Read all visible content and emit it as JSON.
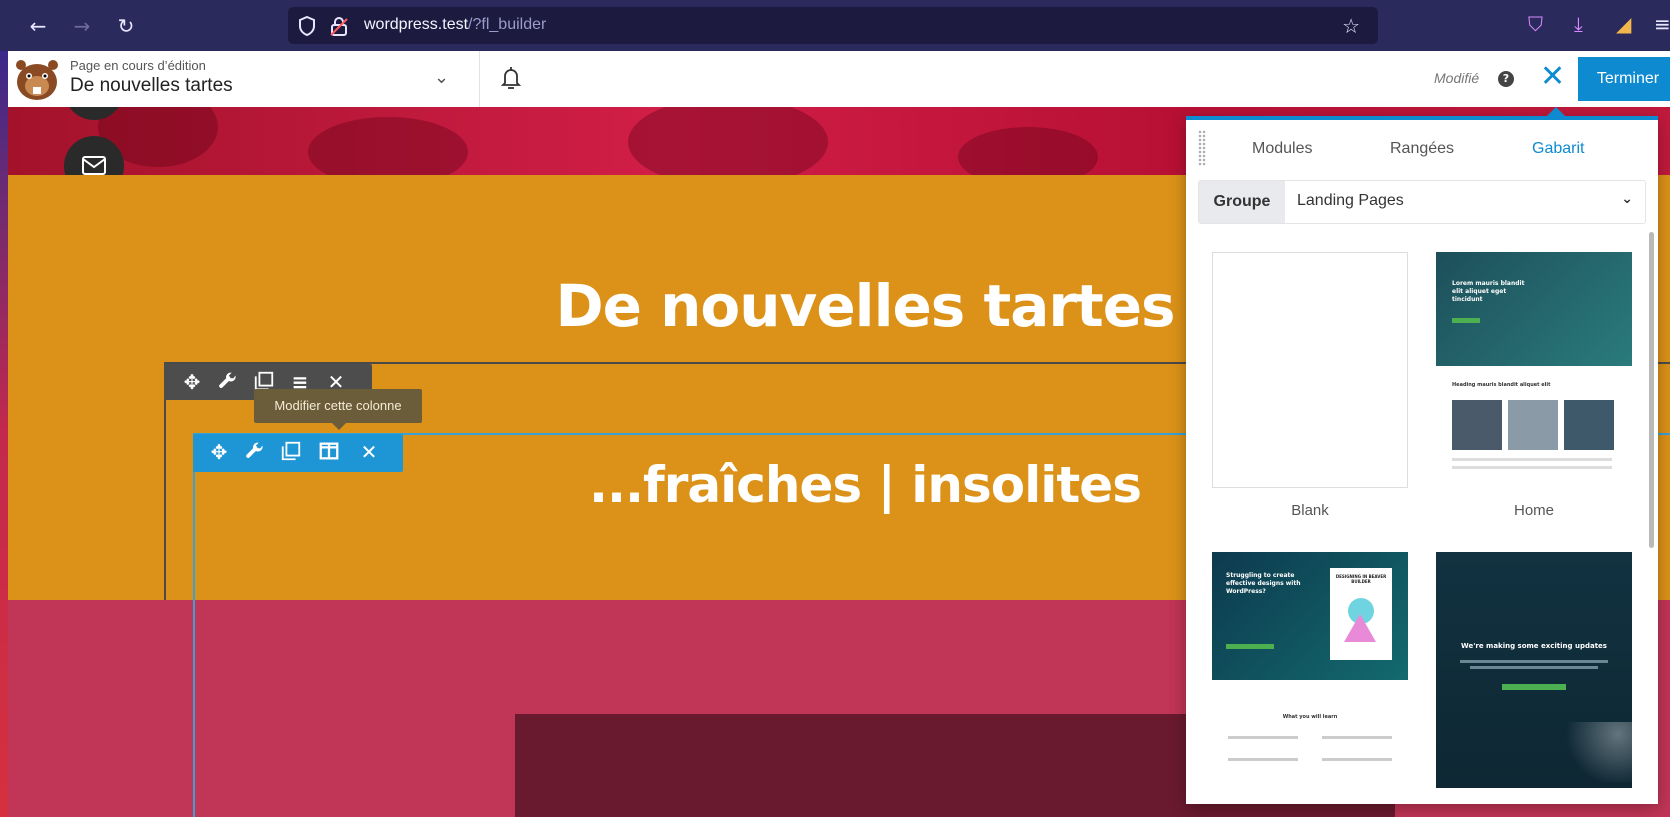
{
  "browser": {
    "url_host": "wordpress.test",
    "url_path": "/?fl_builder"
  },
  "builder_bar": {
    "subtitle": "Page en cours d’édition",
    "page_title": "De nouvelles tartes",
    "status": "Modifié",
    "done_label": "Terminer"
  },
  "page": {
    "heading_1": "De nouvelles tartes",
    "heading_2": "...fraîches | insolites"
  },
  "tooltip": "Modifier cette colonne",
  "panel": {
    "tabs": [
      "Modules",
      "Rangées",
      "Gabarit"
    ],
    "active_tab": "Gabarit",
    "group_label": "Groupe",
    "group_value": "Landing Pages",
    "templates": [
      {
        "label": "Blank"
      },
      {
        "label": "Home"
      }
    ],
    "preview_text": {
      "home_hero": "Lorem mauris blandit elit aliquet eget tincidunt",
      "home_heading": "Heading mauris blandit aliquet elit",
      "t3_hero": "Struggling to create effective designs with WordPress?",
      "t3_book": "DESIGNING IN BEAVER BUILDER",
      "t3_learn": "What you will learn",
      "t4_hero": "We're making some exciting updates"
    }
  },
  "colors": {
    "accent": "#0e8bd0",
    "orange_section": "#dc9218",
    "crimson_section": "#c13556"
  }
}
